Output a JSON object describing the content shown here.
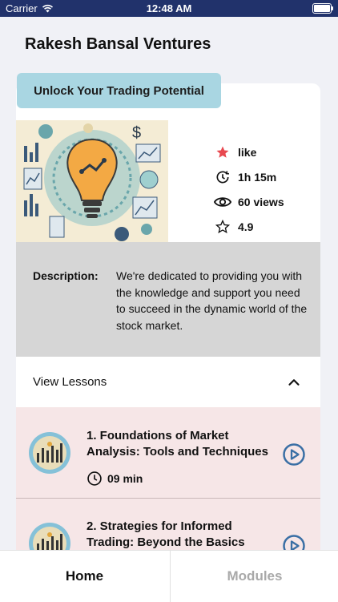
{
  "status_bar": {
    "carrier": "Carrier",
    "time": "12:48 AM"
  },
  "header": {
    "title": "Rakesh Bansal Ventures"
  },
  "course": {
    "banner": "Unlock Your Trading Potential",
    "stats": {
      "like": "like",
      "duration": "1h 15m",
      "views": "60 views",
      "rating": "4.9"
    },
    "description_label": "Description:",
    "description_text": "We're dedicated to providing you with the knowledge and support you need to succeed in the dynamic world of the stock market."
  },
  "lessons": {
    "title": "View Lessons",
    "items": [
      {
        "title": "1. Foundations of Market Analysis: Tools and Techniques",
        "duration": "09 min"
      },
      {
        "title": "2. Strategies for Informed Trading: Beyond the Basics",
        "duration": ""
      }
    ]
  },
  "tabs": {
    "home": "Home",
    "modules": "Modules"
  },
  "colors": {
    "status_bar": "#21326b",
    "banner": "#a9d6e2",
    "accent": "#3a6fa5",
    "like_star": "#e8484f"
  }
}
